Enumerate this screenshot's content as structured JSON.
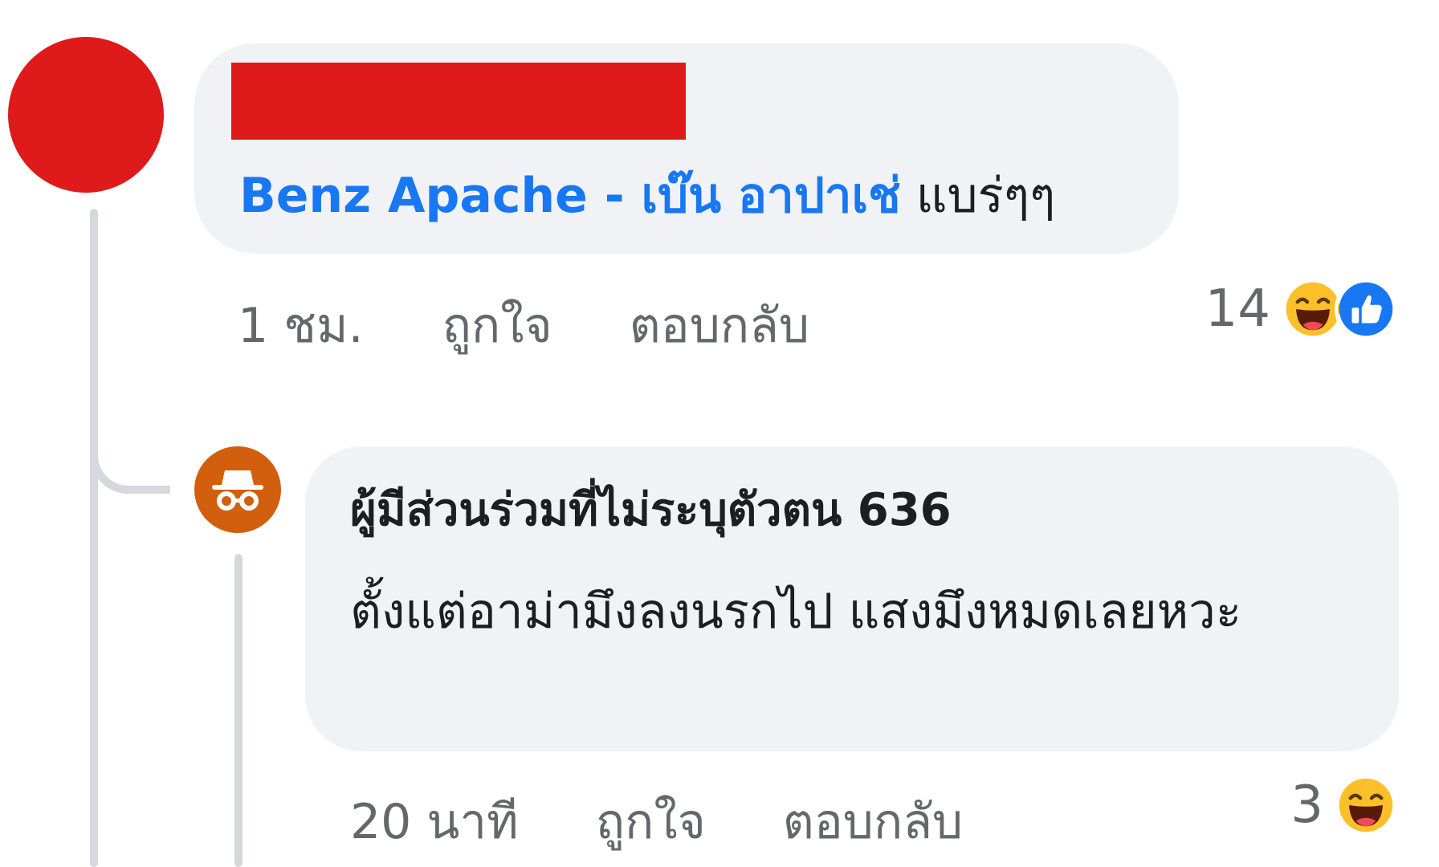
{
  "main_comment": {
    "author": "",
    "mention": "Benz Apache - เบ๊น อาปาเช่",
    "text": " แบร่ๆๆ",
    "time": "1 ชม.",
    "like_label": "ถูกใจ",
    "reply_label": "ตอบกลับ",
    "reaction_count": "14",
    "reactions": [
      "haha-icon",
      "like-icon"
    ]
  },
  "reply_comment": {
    "author": "ผู้มีส่วนร่วมที่ไม่ระบุตัวตน 636",
    "text": "ตั้งแต่อาม่ามึงลงนรกไป แสงมึงหมดเลยหวะ",
    "time": "20 นาที",
    "like_label": "ถูกใจ",
    "reply_label": "ตอบกลับ",
    "reaction_count": "3",
    "reactions": [
      "haha-icon"
    ]
  },
  "colors": {
    "mention": "#1877f2",
    "bubble": "#f0f2f5",
    "meta_text": "#65676b",
    "redaction": "#df1a1a",
    "anon_avatar": "#d25f0d",
    "like_blue": "#1877f2",
    "haha_yellow": "#fbbf2a"
  }
}
